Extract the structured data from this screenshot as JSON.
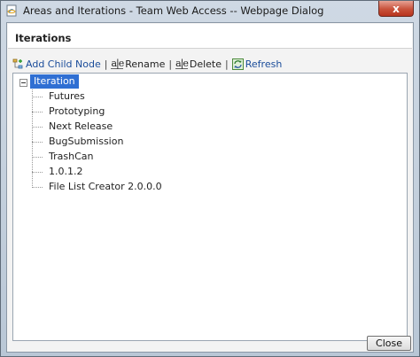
{
  "window": {
    "title": "Areas and Iterations - Team Web Access -- Webpage Dialog",
    "close_glyph": "x"
  },
  "panel": {
    "title": "Iterations"
  },
  "toolbar": {
    "add_child_label": "Add Child Node",
    "rename_label": "Rename",
    "delete_label": "Delete",
    "refresh_label": "Refresh",
    "ae_glyph": "a|e",
    "separator": "|"
  },
  "tree": {
    "root_label": "Iteration",
    "children": [
      "Futures",
      "Prototyping",
      "Next Release",
      "BugSubmission",
      "TrashCan",
      "1.0.1.2",
      "File List Creator 2.0.0.0"
    ]
  },
  "footer": {
    "close_label": "Close"
  },
  "colors": {
    "selection": "#2f6fd3",
    "link": "#1a4c9a",
    "close_button_red": "#c8523b"
  }
}
